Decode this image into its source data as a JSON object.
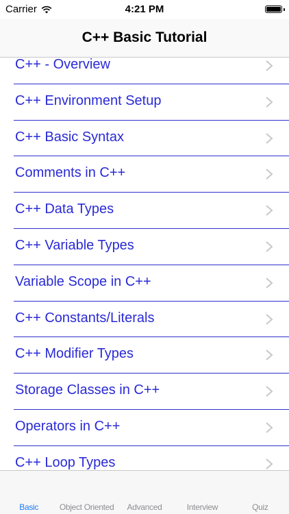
{
  "status_bar": {
    "carrier": "Carrier",
    "time": "4:21 PM",
    "battery_level": 1.0,
    "wifi_icon": "wifi-icon"
  },
  "nav": {
    "title": "C++ Basic Tutorial"
  },
  "list": {
    "items": [
      {
        "label": "C++ - Overview"
      },
      {
        "label": "C++ Environment Setup"
      },
      {
        "label": "C++ Basic Syntax"
      },
      {
        "label": "Comments in C++"
      },
      {
        "label": "C++ Data Types"
      },
      {
        "label": "C++ Variable Types"
      },
      {
        "label": "Variable Scope in C++"
      },
      {
        "label": "C++ Constants/Literals"
      },
      {
        "label": "C++ Modifier Types"
      },
      {
        "label": "Storage Classes in C++"
      },
      {
        "label": "Operators in C++"
      },
      {
        "label": "C++ Loop Types"
      }
    ],
    "chevron_icon": "chevron-right-icon"
  },
  "tabs": [
    {
      "label": "Basic",
      "active": true
    },
    {
      "label": "Object Oriented",
      "active": false
    },
    {
      "label": "Advanced",
      "active": false
    },
    {
      "label": "Interview",
      "active": false
    },
    {
      "label": "Quiz",
      "active": false
    }
  ],
  "colors": {
    "link_blue": "#2a2ad6",
    "separator": "#2f2fd0",
    "tab_active": "#1b7bf5",
    "tab_inactive": "#8e8e93"
  }
}
